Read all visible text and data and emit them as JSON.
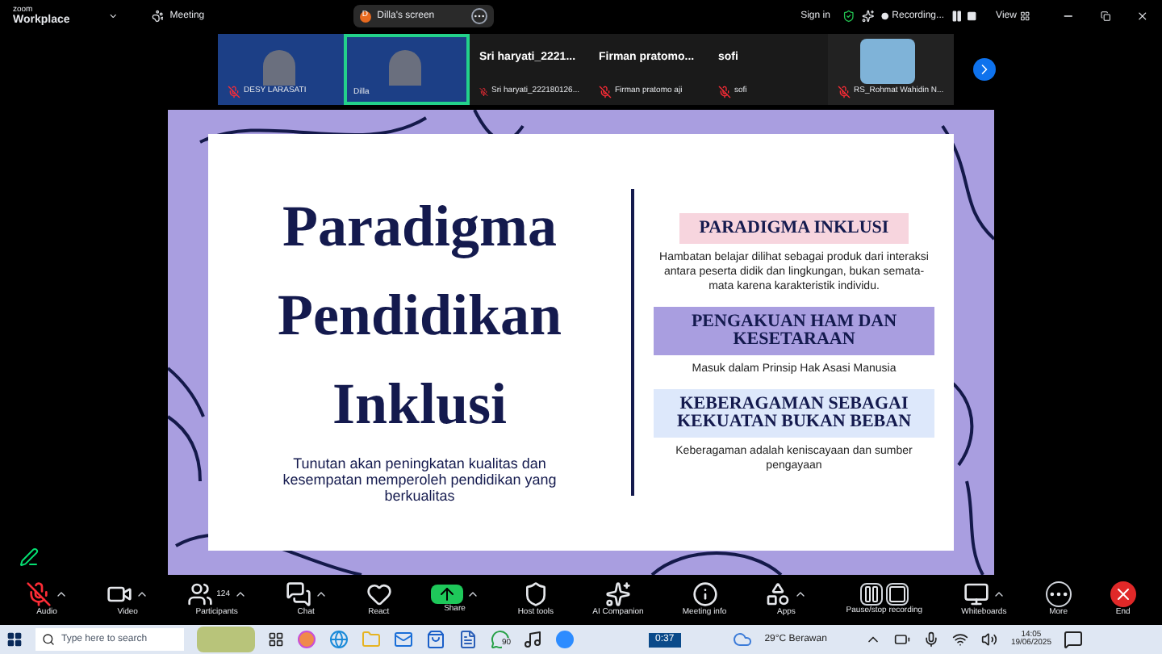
{
  "app": {
    "brand_top": "zoom",
    "brand": "Workplace",
    "meeting": "Meeting"
  },
  "share_pill": {
    "initial": "D",
    "label": "Dilla's screen"
  },
  "top_right": {
    "sign_in": "Sign in",
    "recording": "Recording...",
    "view": "View"
  },
  "participants": [
    {
      "kind": "video",
      "label": "DESY LARASATI",
      "active": false,
      "muted": true
    },
    {
      "kind": "video",
      "label": "Dilla",
      "active": true,
      "muted": false
    },
    {
      "kind": "name",
      "big": "Sri  haryati_2221...",
      "label": "Sri haryati_222180126...",
      "active": false,
      "muted": true
    },
    {
      "kind": "name",
      "big": "Firman  pratomo...",
      "label": "Firman pratomo aji",
      "active": false,
      "muted": true
    },
    {
      "kind": "name",
      "big": "sofi",
      "label": "sofi",
      "active": false,
      "muted": true
    },
    {
      "kind": "photo",
      "label": "RS_Rohmat Wahidin N...",
      "active": false,
      "muted": true
    }
  ],
  "slide": {
    "title": [
      "Paradigma",
      "Pendidikan",
      "Inklusi"
    ],
    "subtitle": "Tunutan akan peningkatan kualitas dan kesempatan memperoleh pendidikan yang berkualitas",
    "points": [
      {
        "heading": "PARADIGMA INKLUSI",
        "color": "#f7d5de",
        "text": "Hambatan belajar dilihat sebagai produk dari interaksi antara peserta didik dan lingkungan, bukan semata-mata karena karakteristik individu."
      },
      {
        "heading": "PENGAKUAN HAM DAN KESETARAAN",
        "color": "#a99ee0",
        "text": "Masuk dalam Prinsip Hak Asasi Manusia"
      },
      {
        "heading": "KEBERAGAMAN SEBAGAI KEKUATAN BUKAN BEBAN",
        "color": "#dde8fb",
        "text": "Keberagaman adalah keniscayaan dan sumber pengayaan"
      }
    ]
  },
  "toolbar": [
    {
      "kind": "audio",
      "label": "Audio",
      "caret": true
    },
    {
      "kind": "video",
      "label": "Video",
      "caret": true
    },
    {
      "kind": "participants",
      "label": "Participants",
      "count": "124",
      "caret": true
    },
    {
      "kind": "chat",
      "label": "Chat",
      "caret": true
    },
    {
      "kind": "react",
      "label": "React",
      "caret": false
    },
    {
      "kind": "share",
      "label": "Share",
      "caret": true
    },
    {
      "kind": "host",
      "label": "Host tools",
      "caret": false
    },
    {
      "kind": "ai",
      "label": "AI Companion",
      "caret": false
    },
    {
      "kind": "info",
      "label": "Meeting info",
      "caret": false
    },
    {
      "kind": "apps",
      "label": "Apps",
      "caret": true
    },
    {
      "kind": "record",
      "label": "Pause/stop recording",
      "caret": false
    },
    {
      "kind": "whiteboard",
      "label": "Whiteboards",
      "caret": true
    },
    {
      "kind": "more",
      "label": "More",
      "caret": false
    },
    {
      "kind": "end",
      "label": "End",
      "caret": false
    }
  ],
  "taskbar": {
    "search_placeholder": "Type here to search",
    "badge": "90",
    "timer": "0:37",
    "weather": "29°C  Berawan",
    "time": "14:05",
    "date": "19/06/2025"
  }
}
